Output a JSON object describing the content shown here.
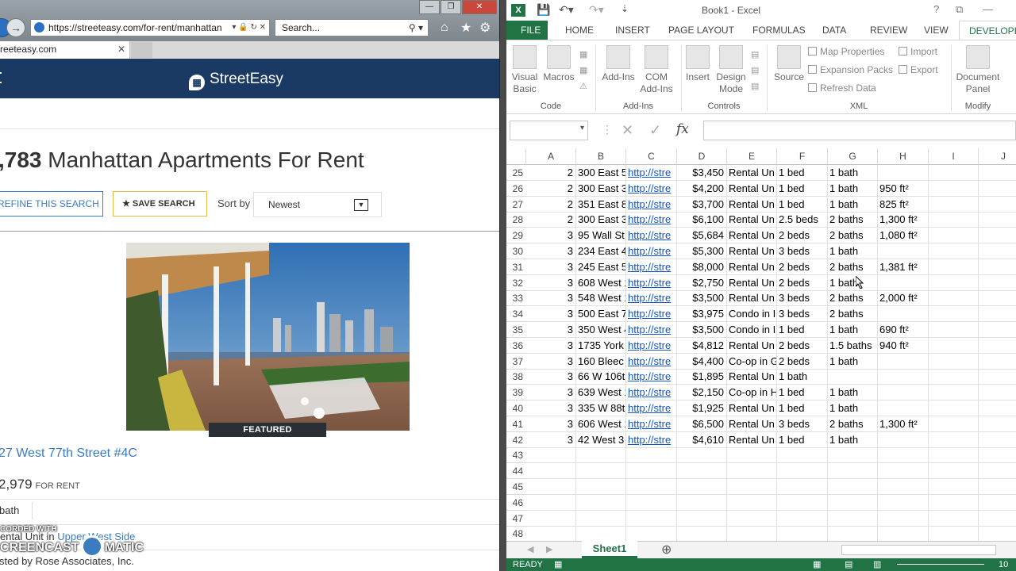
{
  "browser": {
    "url": "https://streeteasy.com/for-rent/manhattan",
    "search_placeholder": "Search...",
    "tab_title": "reeteasy.com",
    "tab_close": "✕",
    "min": "—",
    "max": "❐",
    "close": "✕"
  },
  "site": {
    "logo": "StreetEasy",
    "results_count": ",783",
    "results_text": " Manhattan Apartments For Rent",
    "refine_label": "REFINE THIS SEARCH",
    "save_label": "SAVE SEARCH",
    "sort_label": "Sort by",
    "sort_value": "Newest",
    "featured": "FEATURED",
    "listing_address": "27 West 77th Street #4C",
    "listing_price": "2,979",
    "listing_price_suffix": "FOR RENT",
    "listing_beds": "bath",
    "listing_type": "ental Unit in",
    "listing_neighborhood": "Upper West Side",
    "listing_by": "sted by Rose Associates, Inc."
  },
  "watermark": {
    "line1": "CORDED WITH",
    "line2": "CREENCAST",
    "line3": "MATIC"
  },
  "excel": {
    "title": "Book1 - Excel",
    "tabs": [
      "FILE",
      "HOME",
      "INSERT",
      "PAGE LAYOUT",
      "FORMULAS",
      "DATA",
      "REVIEW",
      "VIEW",
      "DEVELOPER"
    ],
    "ribbon": {
      "visual_basic": "Visual Basic",
      "macros": "Macros",
      "addins": "Add-Ins",
      "com_addins": "COM Add-Ins",
      "insert": "Insert",
      "design_mode": "Design Mode",
      "source": "Source",
      "map_properties": "Map Properties",
      "expansion_packs": "Expansion Packs",
      "refresh_data": "Refresh Data",
      "import": "Import",
      "export": "Export",
      "document_panel": "Document Panel",
      "groups": [
        "Code",
        "Add-Ins",
        "Controls",
        "XML",
        "Modify"
      ]
    },
    "fx": "fx",
    "columns": [
      "A",
      "B",
      "C",
      "D",
      "E",
      "F",
      "G",
      "H",
      "I",
      "J"
    ],
    "rows": [
      {
        "n": "25",
        "a": "2",
        "b": "300 East 5",
        "c": "http://stre",
        "d": "$3,450",
        "e": "Rental Un",
        "f": "1 bed",
        "g": "1 bath",
        "h": ""
      },
      {
        "n": "26",
        "a": "2",
        "b": "300 East 3",
        "c": "http://stre",
        "d": "$4,200",
        "e": "Rental Un",
        "f": "1 bed",
        "g": "1 bath",
        "h": "950 ft²"
      },
      {
        "n": "27",
        "a": "2",
        "b": "351 East 8",
        "c": "http://stre",
        "d": "$3,700",
        "e": "Rental Un",
        "f": "1 bed",
        "g": "1 bath",
        "h": "825 ft²"
      },
      {
        "n": "28",
        "a": "2",
        "b": "300 East 3",
        "c": "http://stre",
        "d": "$6,100",
        "e": "Rental Un",
        "f": "2.5 beds",
        "g": "2 baths",
        "h": "1,300 ft²"
      },
      {
        "n": "29",
        "a": "3",
        "b": "95 Wall St",
        "c": "http://stre",
        "d": "$5,684",
        "e": "Rental Un",
        "f": "2 beds",
        "g": "2 baths",
        "h": "1,080 ft²"
      },
      {
        "n": "30",
        "a": "3",
        "b": "234 East 4",
        "c": "http://stre",
        "d": "$5,300",
        "e": "Rental Un",
        "f": "3 beds",
        "g": "1 bath",
        "h": ""
      },
      {
        "n": "31",
        "a": "3",
        "b": "245 East 5",
        "c": "http://stre",
        "d": "$8,000",
        "e": "Rental Un",
        "f": "2 beds",
        "g": "2 baths",
        "h": "1,381 ft²"
      },
      {
        "n": "32",
        "a": "3",
        "b": "608 West 1",
        "c": "http://stre",
        "d": "$2,750",
        "e": "Rental Un",
        "f": "2 beds",
        "g": "1 bath",
        "h": ""
      },
      {
        "n": "33",
        "a": "3",
        "b": "548 West 1",
        "c": "http://stre",
        "d": "$3,500",
        "e": "Rental Un",
        "f": "3 beds",
        "g": "2 baths",
        "h": "2,000 ft²"
      },
      {
        "n": "34",
        "a": "3",
        "b": "500 East 7",
        "c": "http://stre",
        "d": "$3,975",
        "e": "Condo in I",
        "f": "3 beds",
        "g": "2 baths",
        "h": ""
      },
      {
        "n": "35",
        "a": "3",
        "b": "350 West 4",
        "c": "http://stre",
        "d": "$3,500",
        "e": "Condo in I",
        "f": "1 bed",
        "g": "1 bath",
        "h": "690 ft²"
      },
      {
        "n": "36",
        "a": "3",
        "b": "1735 York",
        "c": "http://stre",
        "d": "$4,812",
        "e": "Rental Un",
        "f": "2 beds",
        "g": "1.5 baths",
        "h": "940 ft²"
      },
      {
        "n": "37",
        "a": "3",
        "b": "160 Bleec",
        "c": "http://stre",
        "d": "$4,400",
        "e": "Co-op in G",
        "f": "2 beds",
        "g": "1 bath",
        "h": ""
      },
      {
        "n": "38",
        "a": "3",
        "b": "66 W 106t",
        "c": "http://stre",
        "d": "$1,895",
        "e": "Rental Un",
        "f": "1 bath",
        "g": "",
        "h": ""
      },
      {
        "n": "39",
        "a": "3",
        "b": "639 West 1",
        "c": "http://stre",
        "d": "$2,150",
        "e": "Co-op in H",
        "f": "1 bed",
        "g": "1 bath",
        "h": ""
      },
      {
        "n": "40",
        "a": "3",
        "b": "335 W 88t",
        "c": "http://stre",
        "d": "$1,925",
        "e": "Rental Un",
        "f": "1 bed",
        "g": "1 bath",
        "h": ""
      },
      {
        "n": "41",
        "a": "3",
        "b": "606 West 1",
        "c": "http://stre",
        "d": "$6,500",
        "e": "Rental Un",
        "f": "3 beds",
        "g": "2 baths",
        "h": "1,300 ft²"
      },
      {
        "n": "42",
        "a": "3",
        "b": "42 West 3",
        "c": "http://stre",
        "d": "$4,610",
        "e": "Rental Un",
        "f": "1 bed",
        "g": "1 bath",
        "h": ""
      },
      {
        "n": "43",
        "a": "",
        "b": "",
        "c": "",
        "d": "",
        "e": "",
        "f": "",
        "g": "",
        "h": ""
      },
      {
        "n": "44",
        "a": "",
        "b": "",
        "c": "",
        "d": "",
        "e": "",
        "f": "",
        "g": "",
        "h": ""
      },
      {
        "n": "45",
        "a": "",
        "b": "",
        "c": "",
        "d": "",
        "e": "",
        "f": "",
        "g": "",
        "h": ""
      },
      {
        "n": "46",
        "a": "",
        "b": "",
        "c": "",
        "d": "",
        "e": "",
        "f": "",
        "g": "",
        "h": ""
      },
      {
        "n": "47",
        "a": "",
        "b": "",
        "c": "",
        "d": "",
        "e": "",
        "f": "",
        "g": "",
        "h": ""
      },
      {
        "n": "48",
        "a": "",
        "b": "",
        "c": "",
        "d": "",
        "e": "",
        "f": "",
        "g": "",
        "h": ""
      }
    ],
    "sheet_tab": "Sheet1",
    "add_sheet": "⊕",
    "status": "READY",
    "zoom": "10"
  },
  "colors": {
    "streeteasy_navy": "#1b3a63",
    "link_blue": "#3b7bbf",
    "excel_green": "#217346",
    "hyperlink": "#1155cc"
  }
}
